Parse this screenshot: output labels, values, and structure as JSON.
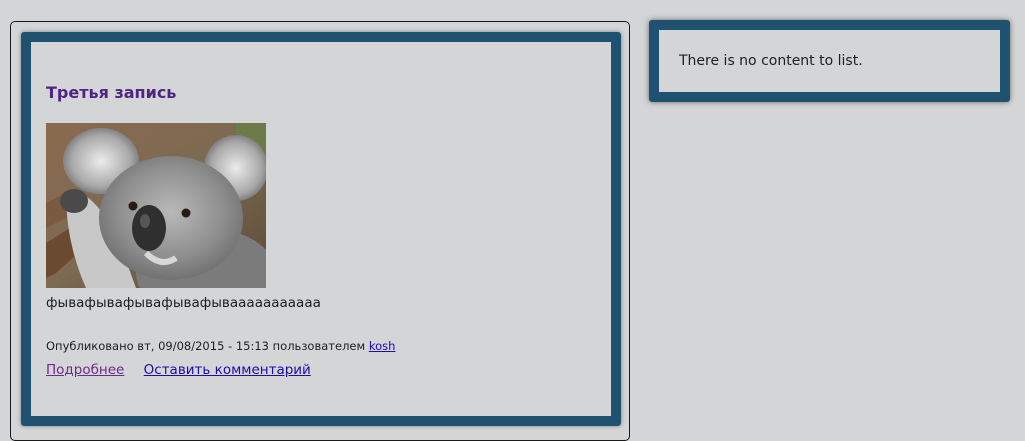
{
  "node": {
    "title": "Третья запись",
    "image_subject": "koala-photo",
    "body": "фывафывафывафывафывааааааааааа",
    "submitted_prefix": "Опубликовано вт, 09/08/2015 - 15:13 пользователем",
    "author": "kosh",
    "links": {
      "read_more": "Подробнее",
      "add_comment": "Оставить комментарий"
    }
  },
  "sidebar": {
    "empty_message": "There is no content to list."
  },
  "colors": {
    "page_background": "#d4d5d7",
    "frame_border": "#1f5170",
    "title": "#4f2583",
    "visited_link": "#6a2b8a",
    "link": "#1a0dab"
  }
}
